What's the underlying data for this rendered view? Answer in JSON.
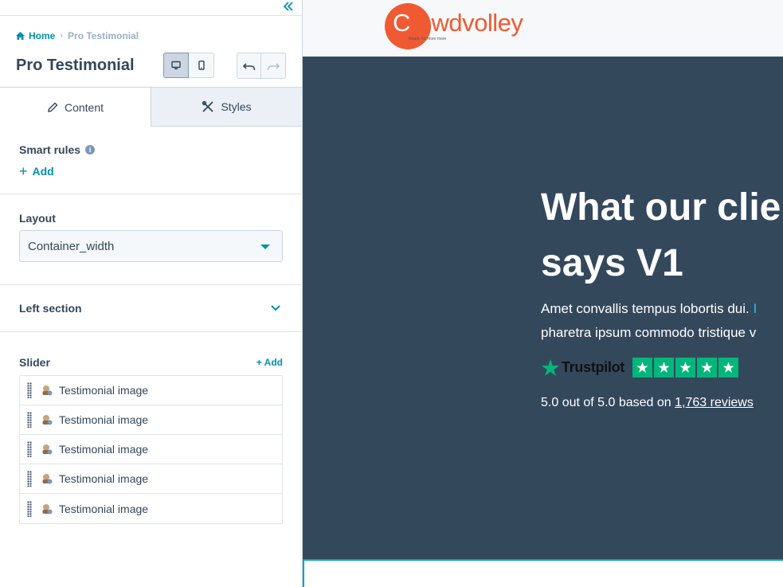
{
  "panel": {
    "collapse_icon": "double-chevron-left-icon",
    "breadcrumb": {
      "home": "Home",
      "current": "Pro Testimonial"
    },
    "title": "Pro Testimonial",
    "tabs": [
      {
        "label": "Content",
        "icon": "pencil-icon",
        "active": true
      },
      {
        "label": "Styles",
        "icon": "tools-icon",
        "active": false
      }
    ],
    "smart_rules": {
      "label": "Smart rules",
      "add_label": "Add"
    },
    "layout": {
      "label": "Layout",
      "value": "Container_width"
    },
    "left_section": {
      "label": "Left section"
    },
    "slider": {
      "label": "Slider",
      "add_label": "+ Add",
      "items": [
        {
          "label": "Testimonial image"
        },
        {
          "label": "Testimonial image"
        },
        {
          "label": "Testimonial image"
        },
        {
          "label": "Testimonial image"
        },
        {
          "label": "Testimonial image"
        }
      ]
    }
  },
  "preview": {
    "logo": {
      "text_first": "C",
      "text_rest": "rowdvolley",
      "tagline": "Ready for more more"
    },
    "hero": {
      "title_line1": "What our clier",
      "title_line2": "says V1",
      "body_line1_plain": "Amet convallis tempus lobortis dui. ",
      "body_line1_link": "I",
      "body_line2": "pharetra ipsum commodo tristique v",
      "trust_name": "Trustpilot",
      "rating_prefix": "5.0 out of 5.0 based on ",
      "rating_link": "1,763 reviews"
    },
    "colors": {
      "brand": "#f05a32",
      "hero_bg": "#34485c",
      "accent": "#0091ae",
      "trustpilot": "#00b67a"
    }
  }
}
